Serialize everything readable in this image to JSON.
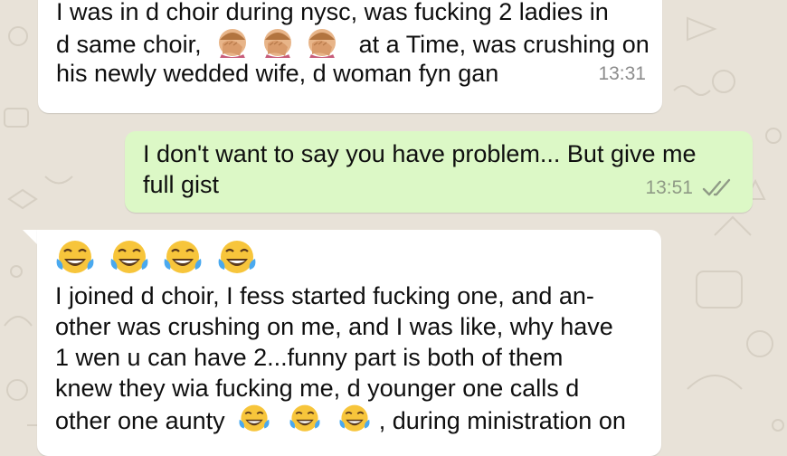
{
  "messages": [
    {
      "direction": "incoming",
      "lines": [
        "I was in d choir during nysc, was fucking 2 ladies in",
        "d same choir,",
        "at a Time, was crushing on",
        "his newly wedded wife, d woman fyn gan"
      ],
      "time": "13:31",
      "emoji": [
        "facepalm-emoji",
        "facepalm-emoji",
        "facepalm-emoji"
      ]
    },
    {
      "direction": "outgoing",
      "lines": [
        "I don't want to say you have problem... But give me",
        "full gist"
      ],
      "time": "13:51",
      "status": "double-check-icon"
    },
    {
      "direction": "incoming",
      "lines": [
        "I joined d choir, I fess started fucking one, and an-",
        "other was crushing on me, and I was like, why have",
        "1 wen u can have 2...funny part is both of them",
        "knew they wia fucking me, d younger one calls d",
        "other one aunty",
        ", during ministration on"
      ],
      "emoji_top": [
        "tears-of-joy-emoji",
        "tears-of-joy-emoji",
        "tears-of-joy-emoji",
        "tears-of-joy-emoji"
      ],
      "emoji_inline": [
        "tears-of-joy-emoji",
        "tears-of-joy-emoji",
        "tears-of-joy-emoji"
      ]
    }
  ],
  "colors": {
    "incoming_bubble": "#ffffff",
    "outgoing_bubble": "#dcf8c6",
    "wallpaper": "#e8e2d8",
    "timestamp": "#8c8c8c"
  }
}
